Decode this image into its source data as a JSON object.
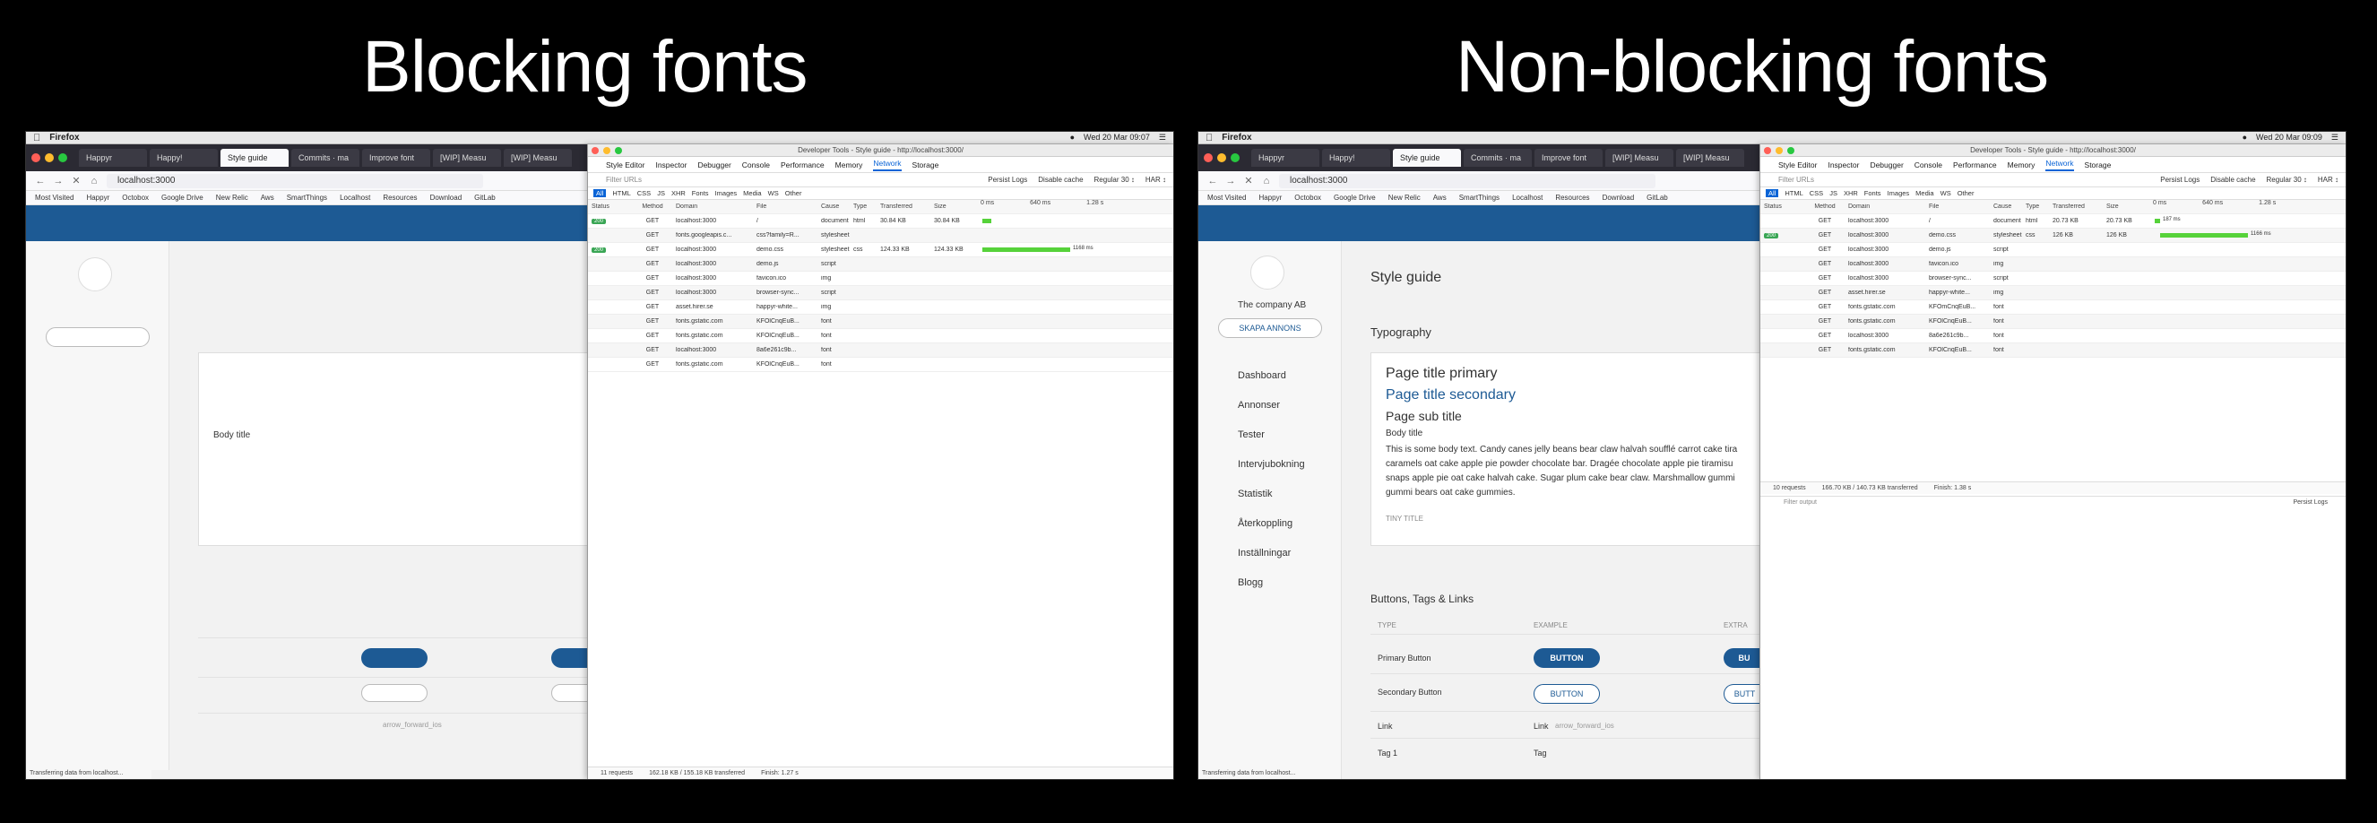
{
  "titles": {
    "left": "Blocking fonts",
    "right": "Non-blocking fonts"
  },
  "colors": {
    "brand_blue": "#1d5a94",
    "devtools_accent": "#0a64d6",
    "waterfall_green": "#56d23a",
    "status_ok": "#3aa655"
  },
  "left": {
    "menubar": {
      "app": "Firefox",
      "clock": "Wed 20 Mar  09:07"
    },
    "tabs": [
      "Happyr",
      "Happy!",
      "Style guide",
      "Commits · ma",
      "Improve font",
      "[WIP] Measu",
      "[WIP] Measu"
    ],
    "url": "localhost:3000",
    "bookmarks": [
      "Most Visited",
      "Happyr",
      "Octobox",
      "Google Drive",
      "New Relic",
      "Aws",
      "SmartThings",
      "Localhost",
      "Resources",
      "Download",
      "GitLab",
      "Happyr Docs"
    ],
    "page": {
      "body_title": "Body title",
      "icon_text": "arrow_forward_ios"
    },
    "status": "Transferring data from localhost...",
    "devtools": {
      "title": "Developer Tools - Style guide - http://localhost:3000/",
      "tabs": [
        "Style Editor",
        "Inspector",
        "Debugger",
        "Console",
        "Performance",
        "Memory",
        "Network",
        "Storage"
      ],
      "filter_placeholder": "Filter URLs",
      "options": [
        "Persist Logs",
        "Disable cache",
        "Regular 30 ↕",
        "HAR ↕"
      ],
      "types": [
        "All",
        "HTML",
        "CSS",
        "JS",
        "XHR",
        "Fonts",
        "Images",
        "Media",
        "WS",
        "Other"
      ],
      "headers": {
        "status": "Status",
        "method": "Method",
        "domain": "Domain",
        "file": "File",
        "cause": "Cause",
        "type": "Type",
        "transferred": "Transferred",
        "size": "Size",
        "t0": "0 ms",
        "t1": "640 ms",
        "t2": "1.28 s"
      },
      "rows": [
        {
          "status": "200",
          "method": "GET",
          "domain": "localhost:3000",
          "file": "/",
          "cause": "document",
          "type": "html",
          "transferred": "30.84 KB",
          "size": "30.84 KB"
        },
        {
          "status": "",
          "method": "GET",
          "domain": "fonts.googleapis.c...",
          "file": "css?family=R...",
          "cause": "stylesheet",
          "type": "",
          "transferred": "",
          "size": ""
        },
        {
          "status": "200",
          "method": "GET",
          "domain": "localhost:3000",
          "file": "demo.css",
          "cause": "stylesheet",
          "type": "css",
          "transferred": "124.33 KB",
          "size": "124.33 KB",
          "wf_label": "1168 ms"
        },
        {
          "status": "",
          "method": "GET",
          "domain": "localhost:3000",
          "file": "demo.js",
          "cause": "script",
          "type": "",
          "transferred": "",
          "size": ""
        },
        {
          "status": "",
          "method": "GET",
          "domain": "localhost:3000",
          "file": "favicon.ico",
          "cause": "img",
          "type": "",
          "transferred": "",
          "size": ""
        },
        {
          "status": "",
          "method": "GET",
          "domain": "localhost:3000",
          "file": "browser-sync...",
          "cause": "script",
          "type": "",
          "transferred": "",
          "size": ""
        },
        {
          "status": "",
          "method": "GET",
          "domain": "asset.hirer.se",
          "file": "happyr-white...",
          "cause": "img",
          "type": "",
          "transferred": "",
          "size": ""
        },
        {
          "status": "",
          "method": "GET",
          "domain": "fonts.gstatic.com",
          "file": "KFOlCnqEuB...",
          "cause": "font",
          "type": "",
          "transferred": "",
          "size": ""
        },
        {
          "status": "",
          "method": "GET",
          "domain": "fonts.gstatic.com",
          "file": "KFOlCnqEuB...",
          "cause": "font",
          "type": "",
          "transferred": "",
          "size": ""
        },
        {
          "status": "",
          "method": "GET",
          "domain": "localhost:3000",
          "file": "8a6e261c9b...",
          "cause": "font",
          "type": "",
          "transferred": "",
          "size": ""
        },
        {
          "status": "",
          "method": "GET",
          "domain": "fonts.gstatic.com",
          "file": "KFOlCnqEuB...",
          "cause": "font",
          "type": "",
          "transferred": "",
          "size": ""
        }
      ],
      "summary": {
        "requests": "11 requests",
        "size": "162.18 KB / 155.18 KB transferred",
        "finish": "Finish: 1.27 s"
      }
    }
  },
  "right": {
    "menubar": {
      "app": "Firefox",
      "clock": "Wed 20 Mar  09:09"
    },
    "tabs": [
      "Happyr",
      "Happy!",
      "Style guide",
      "Commits · ma",
      "Improve font",
      "[WIP] Measu",
      "[WIP] Measu"
    ],
    "url": "localhost:3000",
    "bookmarks": [
      "Most Visited",
      "Happyr",
      "Octobox",
      "Google Drive",
      "New Relic",
      "Aws",
      "SmartThings",
      "Localhost",
      "Resources",
      "Download",
      "GitLab",
      "Happyr Docs"
    ],
    "status": "Transferring data from localhost...",
    "styleguide": {
      "company": "The company AB",
      "ad_button": "SKAPA ANNONS",
      "nav": [
        "Dashboard",
        "Annonser",
        "Tester",
        "Intervjubokning",
        "Statistik",
        "Återkoppling",
        "Inställningar",
        "Blogg"
      ],
      "page_title": "Style guide",
      "typography_heading": "Typography",
      "title_primary": "Page title primary",
      "title_secondary": "Page title secondary",
      "sub_title": "Page sub title",
      "body_title": "Body title",
      "body_text_1": "This is some body text. Candy canes jelly beans bear claw halvah soufflé carrot cake tira",
      "body_text_2": "caramels oat cake apple pie powder chocolate bar. Dragée chocolate apple pie tiramisu",
      "body_text_3": "snaps apple pie oat cake halvah cake. Sugar plum cake bear claw. Marshmallow gummi",
      "body_text_4": "gummi bears oat cake gummies.",
      "tiny_title": "TINY TITLE",
      "buttons_heading": "Buttons, Tags & Links",
      "col_type": "TYPE",
      "col_example": "EXAMPLE",
      "col_extra": "EXTRA",
      "primary_label": "Primary Button",
      "primary_btn": "BUTTON",
      "primary_extra": "BU",
      "secondary_label": "Secondary Button",
      "secondary_btn": "BUTTON",
      "secondary_extra": "BUTT",
      "link_label": "Link",
      "link_example": "Link",
      "link_icon": "arrow_forward_ios",
      "tag_label": "Tag 1",
      "tag_example": "Tag"
    },
    "devtools": {
      "title": "Developer Tools - Style guide - http://localhost:3000/",
      "tabs": [
        "Style Editor",
        "Inspector",
        "Debugger",
        "Console",
        "Performance",
        "Memory",
        "Network",
        "Storage"
      ],
      "filter_placeholder": "Filter URLs",
      "options": [
        "Persist Logs",
        "Disable cache",
        "Regular 30 ↕",
        "HAR ↕"
      ],
      "types": [
        "All",
        "HTML",
        "CSS",
        "JS",
        "XHR",
        "Fonts",
        "Images",
        "Media",
        "WS",
        "Other"
      ],
      "headers": {
        "status": "Status",
        "method": "Method",
        "domain": "Domain",
        "file": "File",
        "cause": "Cause",
        "type": "Type",
        "transferred": "Transferred",
        "size": "Size",
        "t0": "0 ms",
        "t1": "640 ms",
        "t2": "1.28 s"
      },
      "rows": [
        {
          "status": "",
          "method": "GET",
          "domain": "localhost:3000",
          "file": "/",
          "cause": "document",
          "type": "html",
          "transferred": "20.73 KB",
          "size": "20.73 KB",
          "wf_label": "187 ms"
        },
        {
          "status": "200",
          "method": "GET",
          "domain": "localhost:3000",
          "file": "demo.css",
          "cause": "stylesheet",
          "type": "css",
          "transferred": "126 KB",
          "size": "126 KB",
          "wf_label": "1166 ms"
        },
        {
          "status": "",
          "method": "GET",
          "domain": "localhost:3000",
          "file": "demo.js",
          "cause": "script",
          "type": "",
          "transferred": "",
          "size": ""
        },
        {
          "status": "",
          "method": "GET",
          "domain": "localhost:3000",
          "file": "favicon.ico",
          "cause": "img",
          "type": "",
          "transferred": "",
          "size": ""
        },
        {
          "status": "",
          "method": "GET",
          "domain": "localhost:3000",
          "file": "browser-sync...",
          "cause": "script",
          "type": "",
          "transferred": "",
          "size": ""
        },
        {
          "status": "",
          "method": "GET",
          "domain": "asset.hirer.se",
          "file": "happyr-white...",
          "cause": "img",
          "type": "",
          "transferred": "",
          "size": ""
        },
        {
          "status": "",
          "method": "GET",
          "domain": "fonts.gstatic.com",
          "file": "KFOmCnqEuB...",
          "cause": "font",
          "type": "",
          "transferred": "",
          "size": ""
        },
        {
          "status": "",
          "method": "GET",
          "domain": "fonts.gstatic.com",
          "file": "KFOlCnqEuB...",
          "cause": "font",
          "type": "",
          "transferred": "",
          "size": ""
        },
        {
          "status": "",
          "method": "GET",
          "domain": "localhost:3000",
          "file": "8a6e261c9b...",
          "cause": "font",
          "type": "",
          "transferred": "",
          "size": ""
        },
        {
          "status": "",
          "method": "GET",
          "domain": "fonts.gstatic.com",
          "file": "KFOlCnqEuB...",
          "cause": "font",
          "type": "",
          "transferred": "",
          "size": ""
        }
      ],
      "summary": {
        "requests": "10 requests",
        "size": "166.70 KB / 140.73 KB transferred",
        "finish": "Finish: 1.38 s"
      },
      "console_filter": "Filter output",
      "persist_logs": "Persist Logs"
    }
  }
}
